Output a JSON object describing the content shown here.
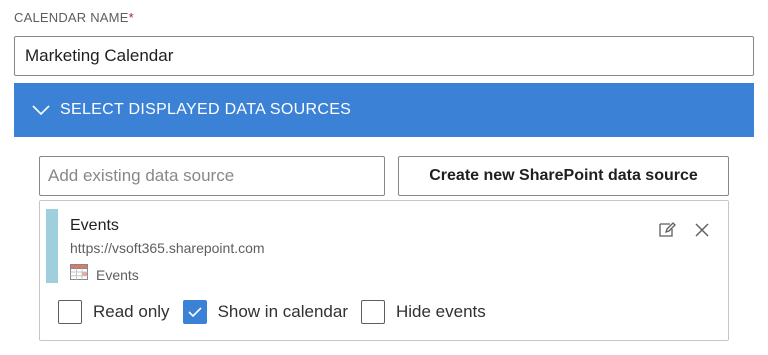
{
  "calendar": {
    "label": "CALENDAR NAME",
    "required_mark": "*",
    "value": "Marketing Calendar"
  },
  "section": {
    "title": "SELECT DISPLAYED DATA SOURCES",
    "expanded": true,
    "color": "#3b82d6"
  },
  "datasource": {
    "placeholder": "Add existing data source",
    "create_label": "Create new SharePoint data source"
  },
  "source": {
    "name": "Events",
    "url": "https://vsoft365.sharepoint.com",
    "list_name": "Events",
    "accent_color": "#9fcfdc",
    "options": [
      {
        "label": "Read only",
        "checked": false
      },
      {
        "label": "Show in calendar",
        "checked": true
      },
      {
        "label": "Hide events",
        "checked": false
      }
    ]
  }
}
